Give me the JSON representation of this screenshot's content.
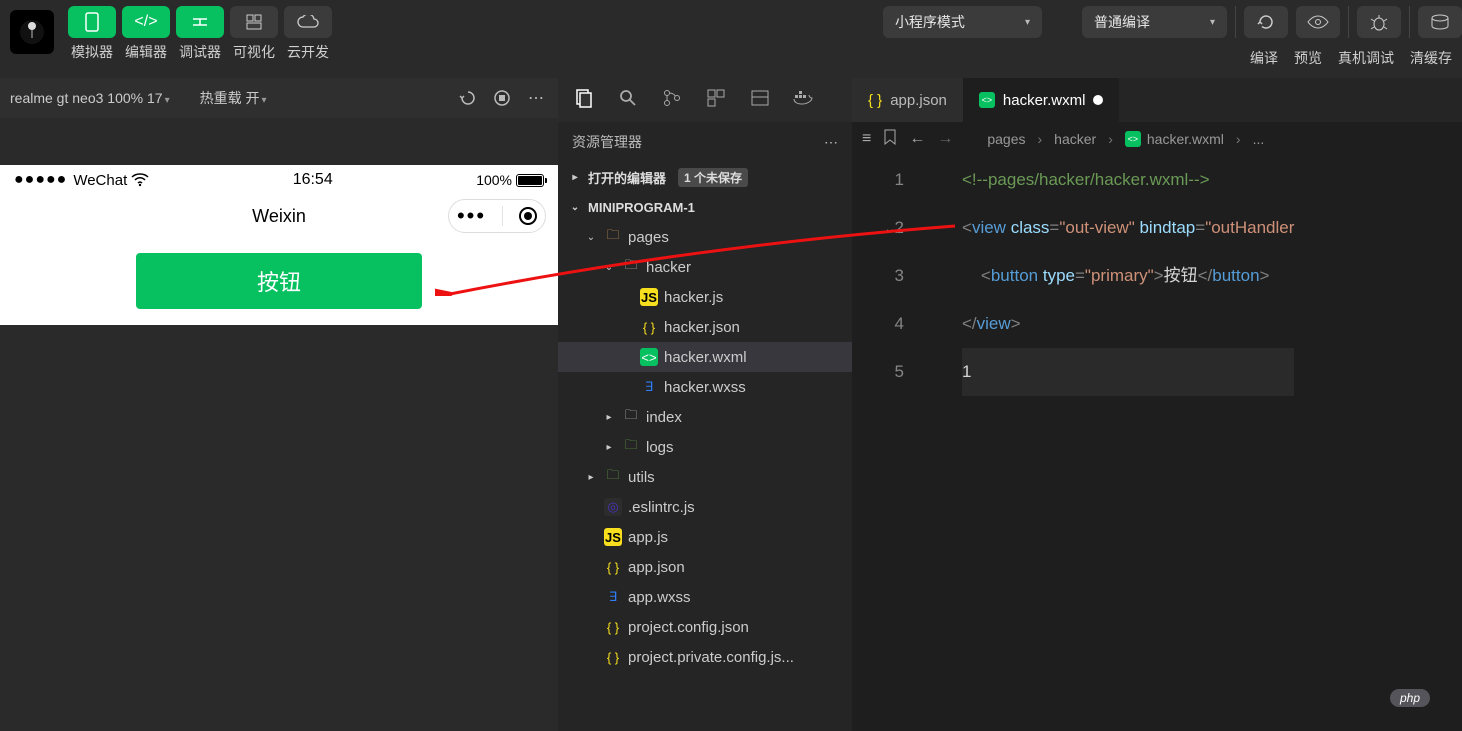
{
  "toolbar": {
    "simulator": "模拟器",
    "editor": "编辑器",
    "debugger": "调试器",
    "visualize": "可视化",
    "cloud": "云开发",
    "mode_dd": "小程序模式",
    "compile_dd": "普通编译",
    "compile": "编译",
    "preview": "预览",
    "real_debug": "真机调试",
    "clear_cache": "清缓存"
  },
  "simbar": {
    "device": "realme gt neo3 100% 17",
    "hotreload": "热重载 开"
  },
  "phone": {
    "carrier": "WeChat",
    "time": "16:54",
    "battery": "100%",
    "title": "Weixin",
    "button": "按钮"
  },
  "explorer": {
    "title": "资源管理器",
    "open_editors": "打开的编辑器",
    "unsaved_badge": "1 个未保存",
    "project": "MINIPROGRAM-1",
    "tree": {
      "pages": "pages",
      "hacker": "hacker",
      "hacker_js": "hacker.js",
      "hacker_json": "hacker.json",
      "hacker_wxml": "hacker.wxml",
      "hacker_wxss": "hacker.wxss",
      "index": "index",
      "logs": "logs",
      "utils": "utils",
      "eslint": ".eslintrc.js",
      "app_js": "app.js",
      "app_json": "app.json",
      "app_wxss": "app.wxss",
      "proj_config": "project.config.json",
      "proj_priv": "project.private.config.js..."
    }
  },
  "tabs": {
    "app_json": "app.json",
    "hacker_wxml": "hacker.wxml"
  },
  "breadcrumb": {
    "p1": "pages",
    "p2": "hacker",
    "p3": "hacker.wxml",
    "p4": "..."
  },
  "code": {
    "line_numbers": [
      "1",
      "2",
      "3",
      "4",
      "5"
    ],
    "l1_comment": "<!--pages/hacker/hacker.wxml-->",
    "l2_tag_open": "<",
    "l2_tag": "view",
    "l2_a1": "class",
    "l2_v1": "\"out-view\"",
    "l2_a2": "bindtap",
    "l2_v2": "\"outHandler",
    "l3_tag": "button",
    "l3_a1": "type",
    "l3_v1": "\"primary\"",
    "l3_text": "按钮",
    "l4_close": "</",
    "l4_tag": "view",
    "l5": "1"
  },
  "watermark": "php"
}
